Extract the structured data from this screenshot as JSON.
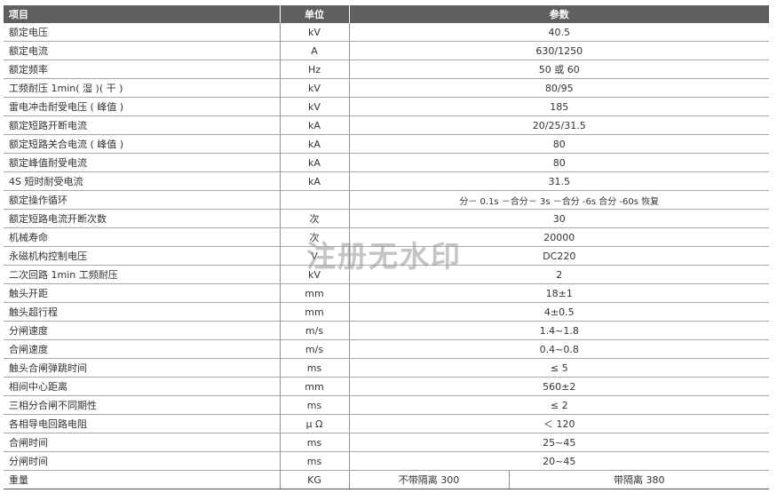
{
  "header": {
    "item": "项目",
    "unit": "单位",
    "param": "参数"
  },
  "rows": [
    {
      "item": "额定电压",
      "unit": "kV",
      "value": "40.5"
    },
    {
      "item": "额定电流",
      "unit": "A",
      "value": "630/1250"
    },
    {
      "item": "额定频率",
      "unit": "Hz",
      "value": "50 或 60"
    },
    {
      "item": "工频耐压 1min( 湿 )( 干 )",
      "unit": "kV",
      "value": "80/95"
    },
    {
      "item": "雷电冲击耐受电压 ( 峰值 )",
      "unit": "kV",
      "value": "185"
    },
    {
      "item": "额定短路开断电流",
      "unit": "kA",
      "value": "20/25/31.5"
    },
    {
      "item": "额定短路关合电流 ( 峰值 )",
      "unit": "kA",
      "value": "80"
    },
    {
      "item": "额定峰值耐受电流",
      "unit": "kA",
      "value": "80"
    },
    {
      "item": "4S 短时耐受电流",
      "unit": "kA",
      "value": "31.5"
    },
    {
      "item": "额定操作循环",
      "unit": "",
      "value": "分－ 0.1s －合分－ 3s －合分 -6s 合分 -60s 恢复"
    },
    {
      "item": "额定短路电流开断次数",
      "unit": "次",
      "value": "30"
    },
    {
      "item": "机械寿命",
      "unit": "次",
      "value": "20000"
    },
    {
      "item": "永磁机构控制电压",
      "unit": "V",
      "value": "DC220"
    },
    {
      "item": "二次回路 1min 工频耐压",
      "unit": "kV",
      "value": "2"
    },
    {
      "item": "触头开距",
      "unit": "mm",
      "value": "18±1"
    },
    {
      "item": "触头超行程",
      "unit": "mm",
      "value": "4±0.5"
    },
    {
      "item": "分闸速度",
      "unit": "m/s",
      "value": "1.4~1.8"
    },
    {
      "item": "合闸速度",
      "unit": "m/s",
      "value": "0.4~0.8"
    },
    {
      "item": "触头合闸弹跳时间",
      "unit": "ms",
      "value": "≤ 5"
    },
    {
      "item": "相间中心距离",
      "unit": "mm",
      "value": "560±2"
    },
    {
      "item": "三相分合闸不同期性",
      "unit": "ms",
      "value": "≤ 2"
    },
    {
      "item": "各相导电回路电阻",
      "unit": "μ Ω",
      "value": "＜ 120"
    },
    {
      "item": "合闸时间",
      "unit": "ms",
      "value": "25~45"
    },
    {
      "item": "分闸时间",
      "unit": "ms",
      "value": "20~45"
    }
  ],
  "weight": {
    "item": "重量",
    "unit": "KG",
    "value_a": "不带隔离 300",
    "value_b": "带隔离 380"
  },
  "watermark": "注册无水印"
}
